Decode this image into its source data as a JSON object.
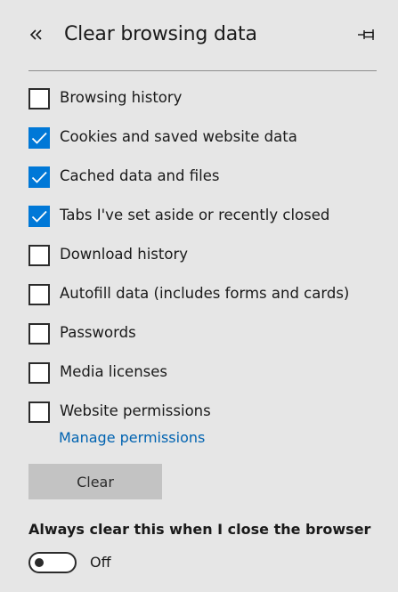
{
  "header": {
    "title": "Clear browsing data",
    "back_icon": "double-chevron-left-icon",
    "pin_icon": "pin-icon"
  },
  "options": [
    {
      "label": "Browsing history",
      "checked": false
    },
    {
      "label": "Cookies and saved website data",
      "checked": true
    },
    {
      "label": "Cached data and files",
      "checked": true
    },
    {
      "label": "Tabs I've set aside or recently closed",
      "checked": true
    },
    {
      "label": "Download history",
      "checked": false
    },
    {
      "label": "Autofill data (includes forms and cards)",
      "checked": false
    },
    {
      "label": "Passwords",
      "checked": false
    },
    {
      "label": "Media licenses",
      "checked": false
    },
    {
      "label": "Website permissions",
      "checked": false
    }
  ],
  "manage_link": "Manage permissions",
  "clear_button": "Clear",
  "auto_clear": {
    "heading": "Always clear this when I close the browser",
    "state_label": "Off",
    "enabled": false
  },
  "colors": {
    "background": "#e6e6e6",
    "accent": "#0078d7",
    "link": "#0063b1",
    "button": "#c3c3c3"
  }
}
